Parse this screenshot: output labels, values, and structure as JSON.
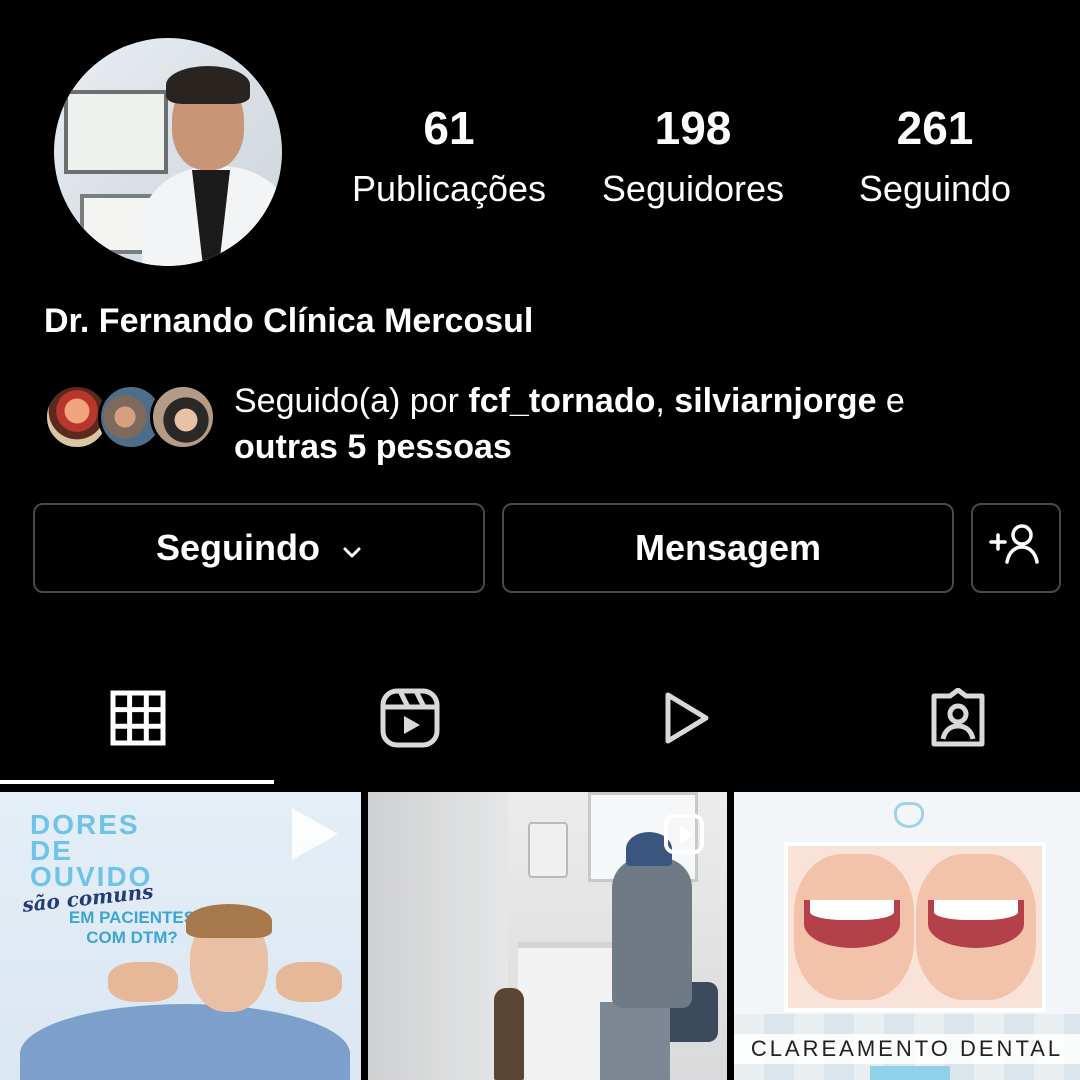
{
  "profile": {
    "display_name": "Dr. Fernando Clínica Mercosul",
    "stats": [
      {
        "value": "61",
        "label": "Publicações"
      },
      {
        "value": "198",
        "label": "Seguidores"
      },
      {
        "value": "261",
        "label": "Seguindo"
      }
    ]
  },
  "followed_by": {
    "prefix": "Seguido(a) por ",
    "user1": "fcf_tornado",
    "separator": ", ",
    "user2": "silviarnjorge",
    "conjunction": " e",
    "others": "outras 5 pessoas"
  },
  "actions": {
    "following_label": "Seguindo",
    "message_label": "Mensagem"
  },
  "tabs": [
    {
      "icon": "grid-icon",
      "active": true
    },
    {
      "icon": "reels-icon",
      "active": false
    },
    {
      "icon": "video-play-icon",
      "active": false
    },
    {
      "icon": "tagged-icon",
      "active": false
    }
  ],
  "posts": [
    {
      "title_lines": [
        "DORES",
        "DE",
        "OUVIDO"
      ],
      "script": "são comuns",
      "subtitle": "EM PACIENTES COM DTM?"
    },
    {
      "type": "reel"
    },
    {
      "caption": "CLAREAMENTO DENTAL"
    }
  ],
  "colors": {
    "background": "#000000",
    "button_border": "#4a4a4a",
    "text": "#ffffff"
  }
}
